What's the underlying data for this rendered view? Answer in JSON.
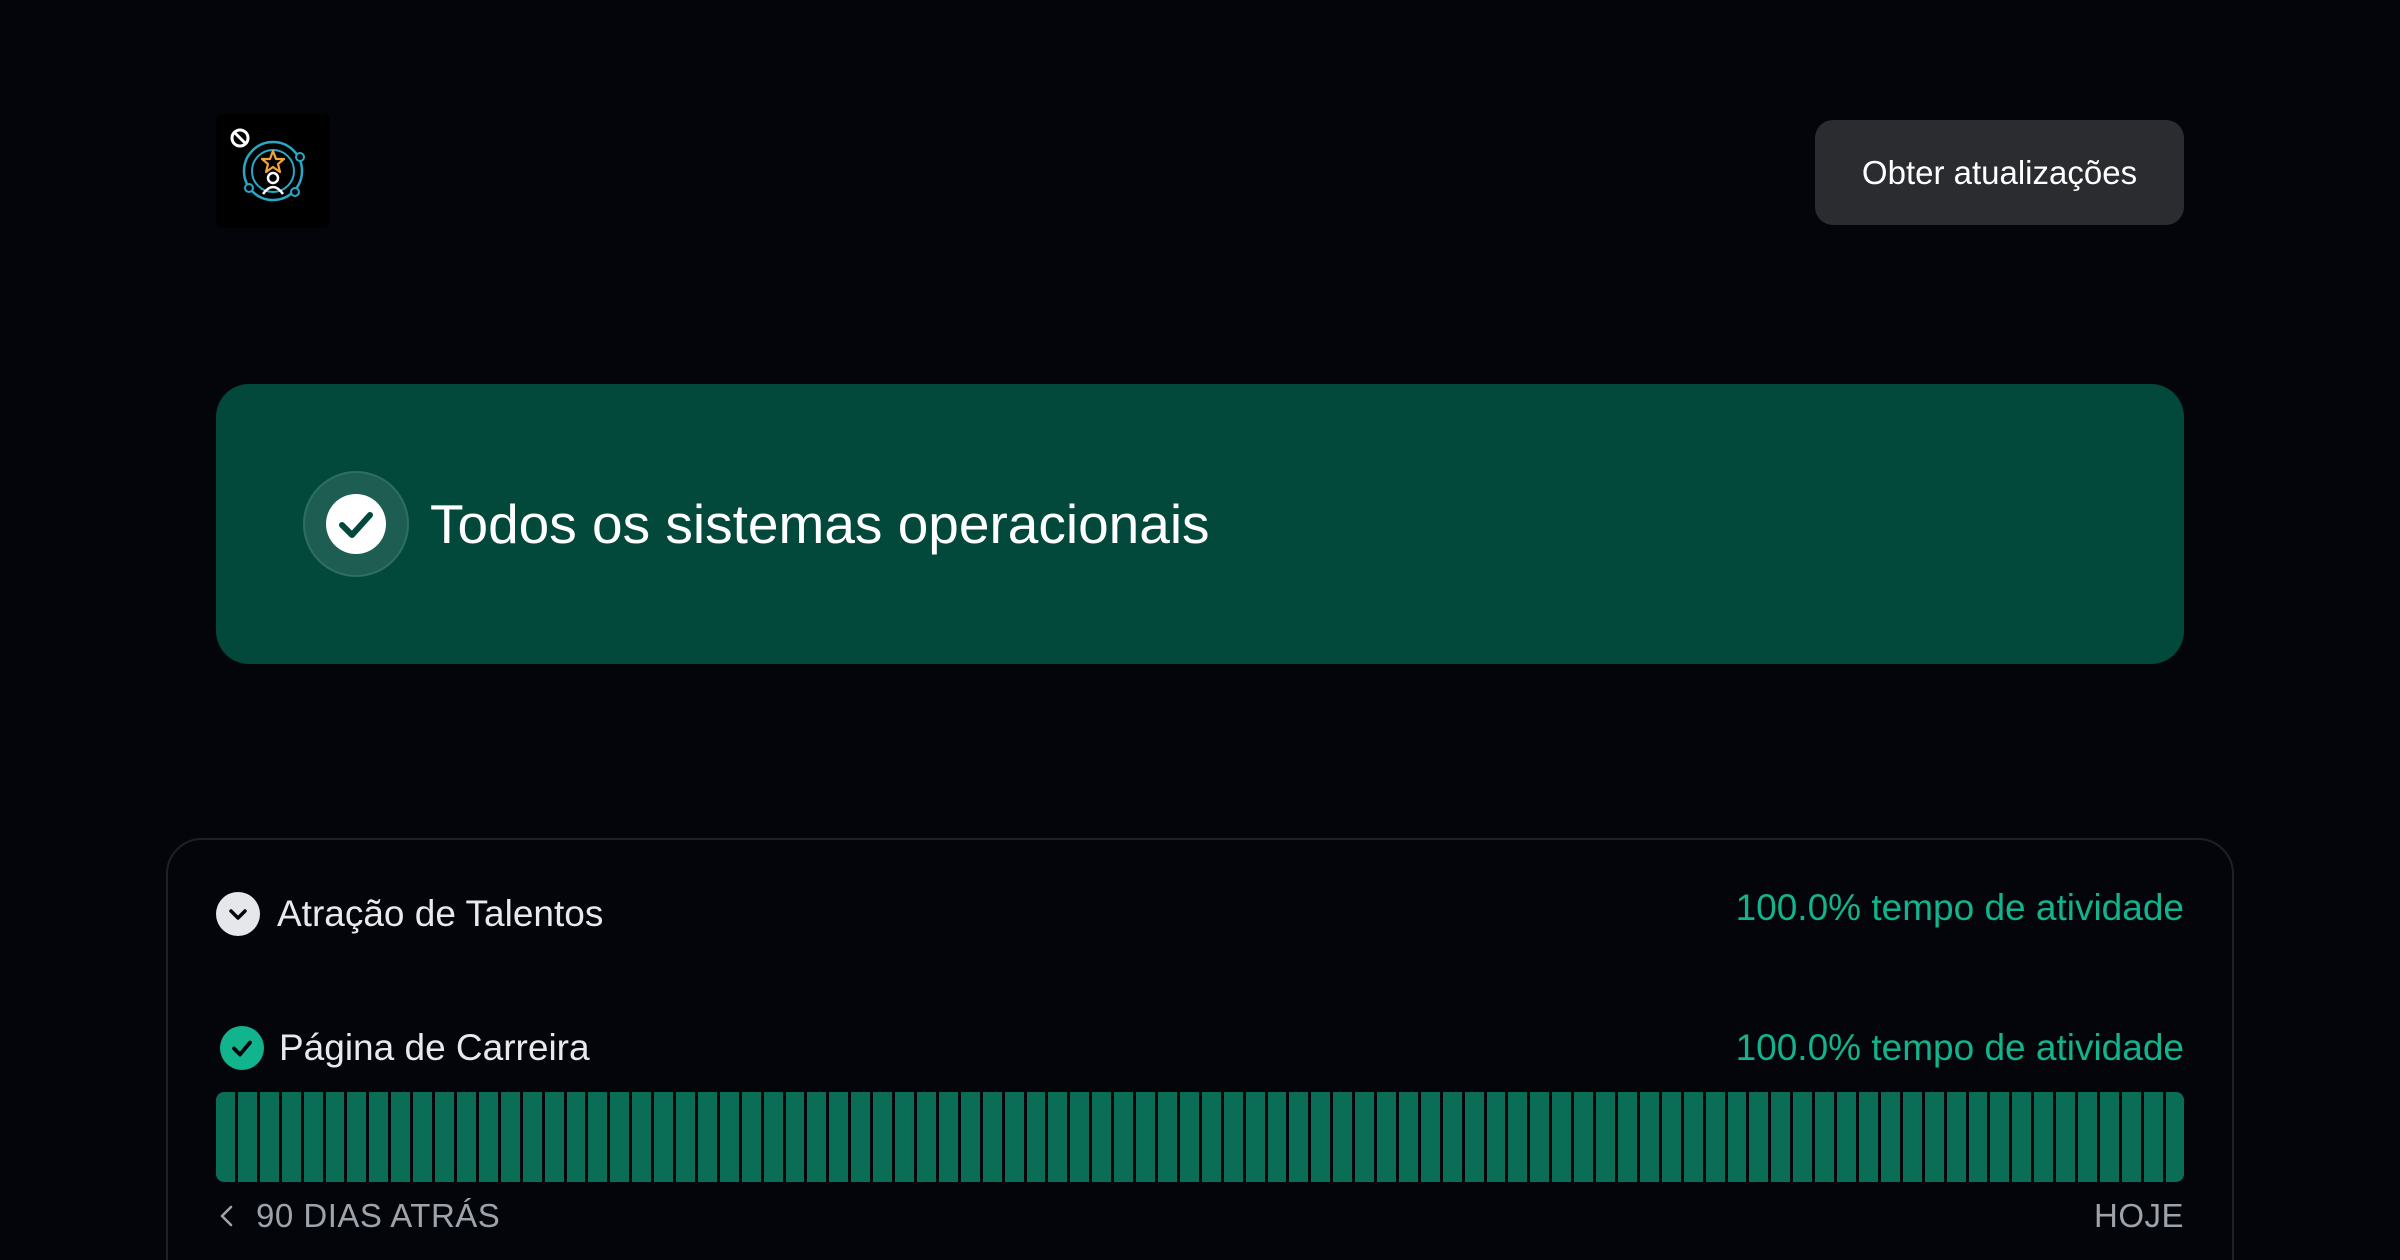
{
  "header": {
    "logo_icon": "talent-attraction-logo-icon",
    "subscribe_label": "Obter atualizações"
  },
  "banner": {
    "status_text": "Todos os sistemas operacionais",
    "status_icon": "check-circle-icon",
    "color": "#02493c"
  },
  "group": {
    "name": "Atração de Talentos",
    "uptime": "100.0% tempo de atividade",
    "toggle_icon": "chevron-down-icon"
  },
  "component": {
    "name": "Página de Carreira",
    "uptime": "100.0% tempo de atividade",
    "status_icon": "check-circle-icon",
    "uptime_days": 90,
    "bar_status": "operational",
    "bar_color": "#0a6e56"
  },
  "axis": {
    "start_label": "90 DIAS ATRÁS",
    "end_label": "HOJE"
  },
  "colors": {
    "background": "#03050a",
    "accent_green": "#12b48d",
    "button_bg": "#2b2c30"
  }
}
